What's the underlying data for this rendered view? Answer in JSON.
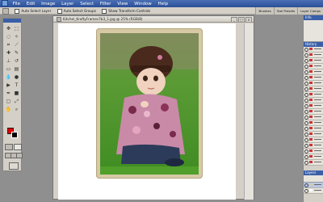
{
  "menu": [
    "File",
    "Edit",
    "Image",
    "Layer",
    "Select",
    "Filter",
    "View",
    "Window",
    "Help"
  ],
  "options": {
    "auto_select_layer": "Auto Select Layer",
    "auto_select_groups": "Auto Select Groups",
    "show_transform_controls": "Show Transform Controls"
  },
  "workspace_tabs": [
    "Brushes",
    "Tool Presets",
    "Layer Comps"
  ],
  "document": {
    "title": "Kitchel_KraftyFrames7b3_1.jpg @ 25% (RGB/8)"
  },
  "panels": {
    "info": "Info",
    "history": "History",
    "layers": "Layers"
  },
  "colors": {
    "foreground": "#e00000",
    "background": "#000000"
  }
}
